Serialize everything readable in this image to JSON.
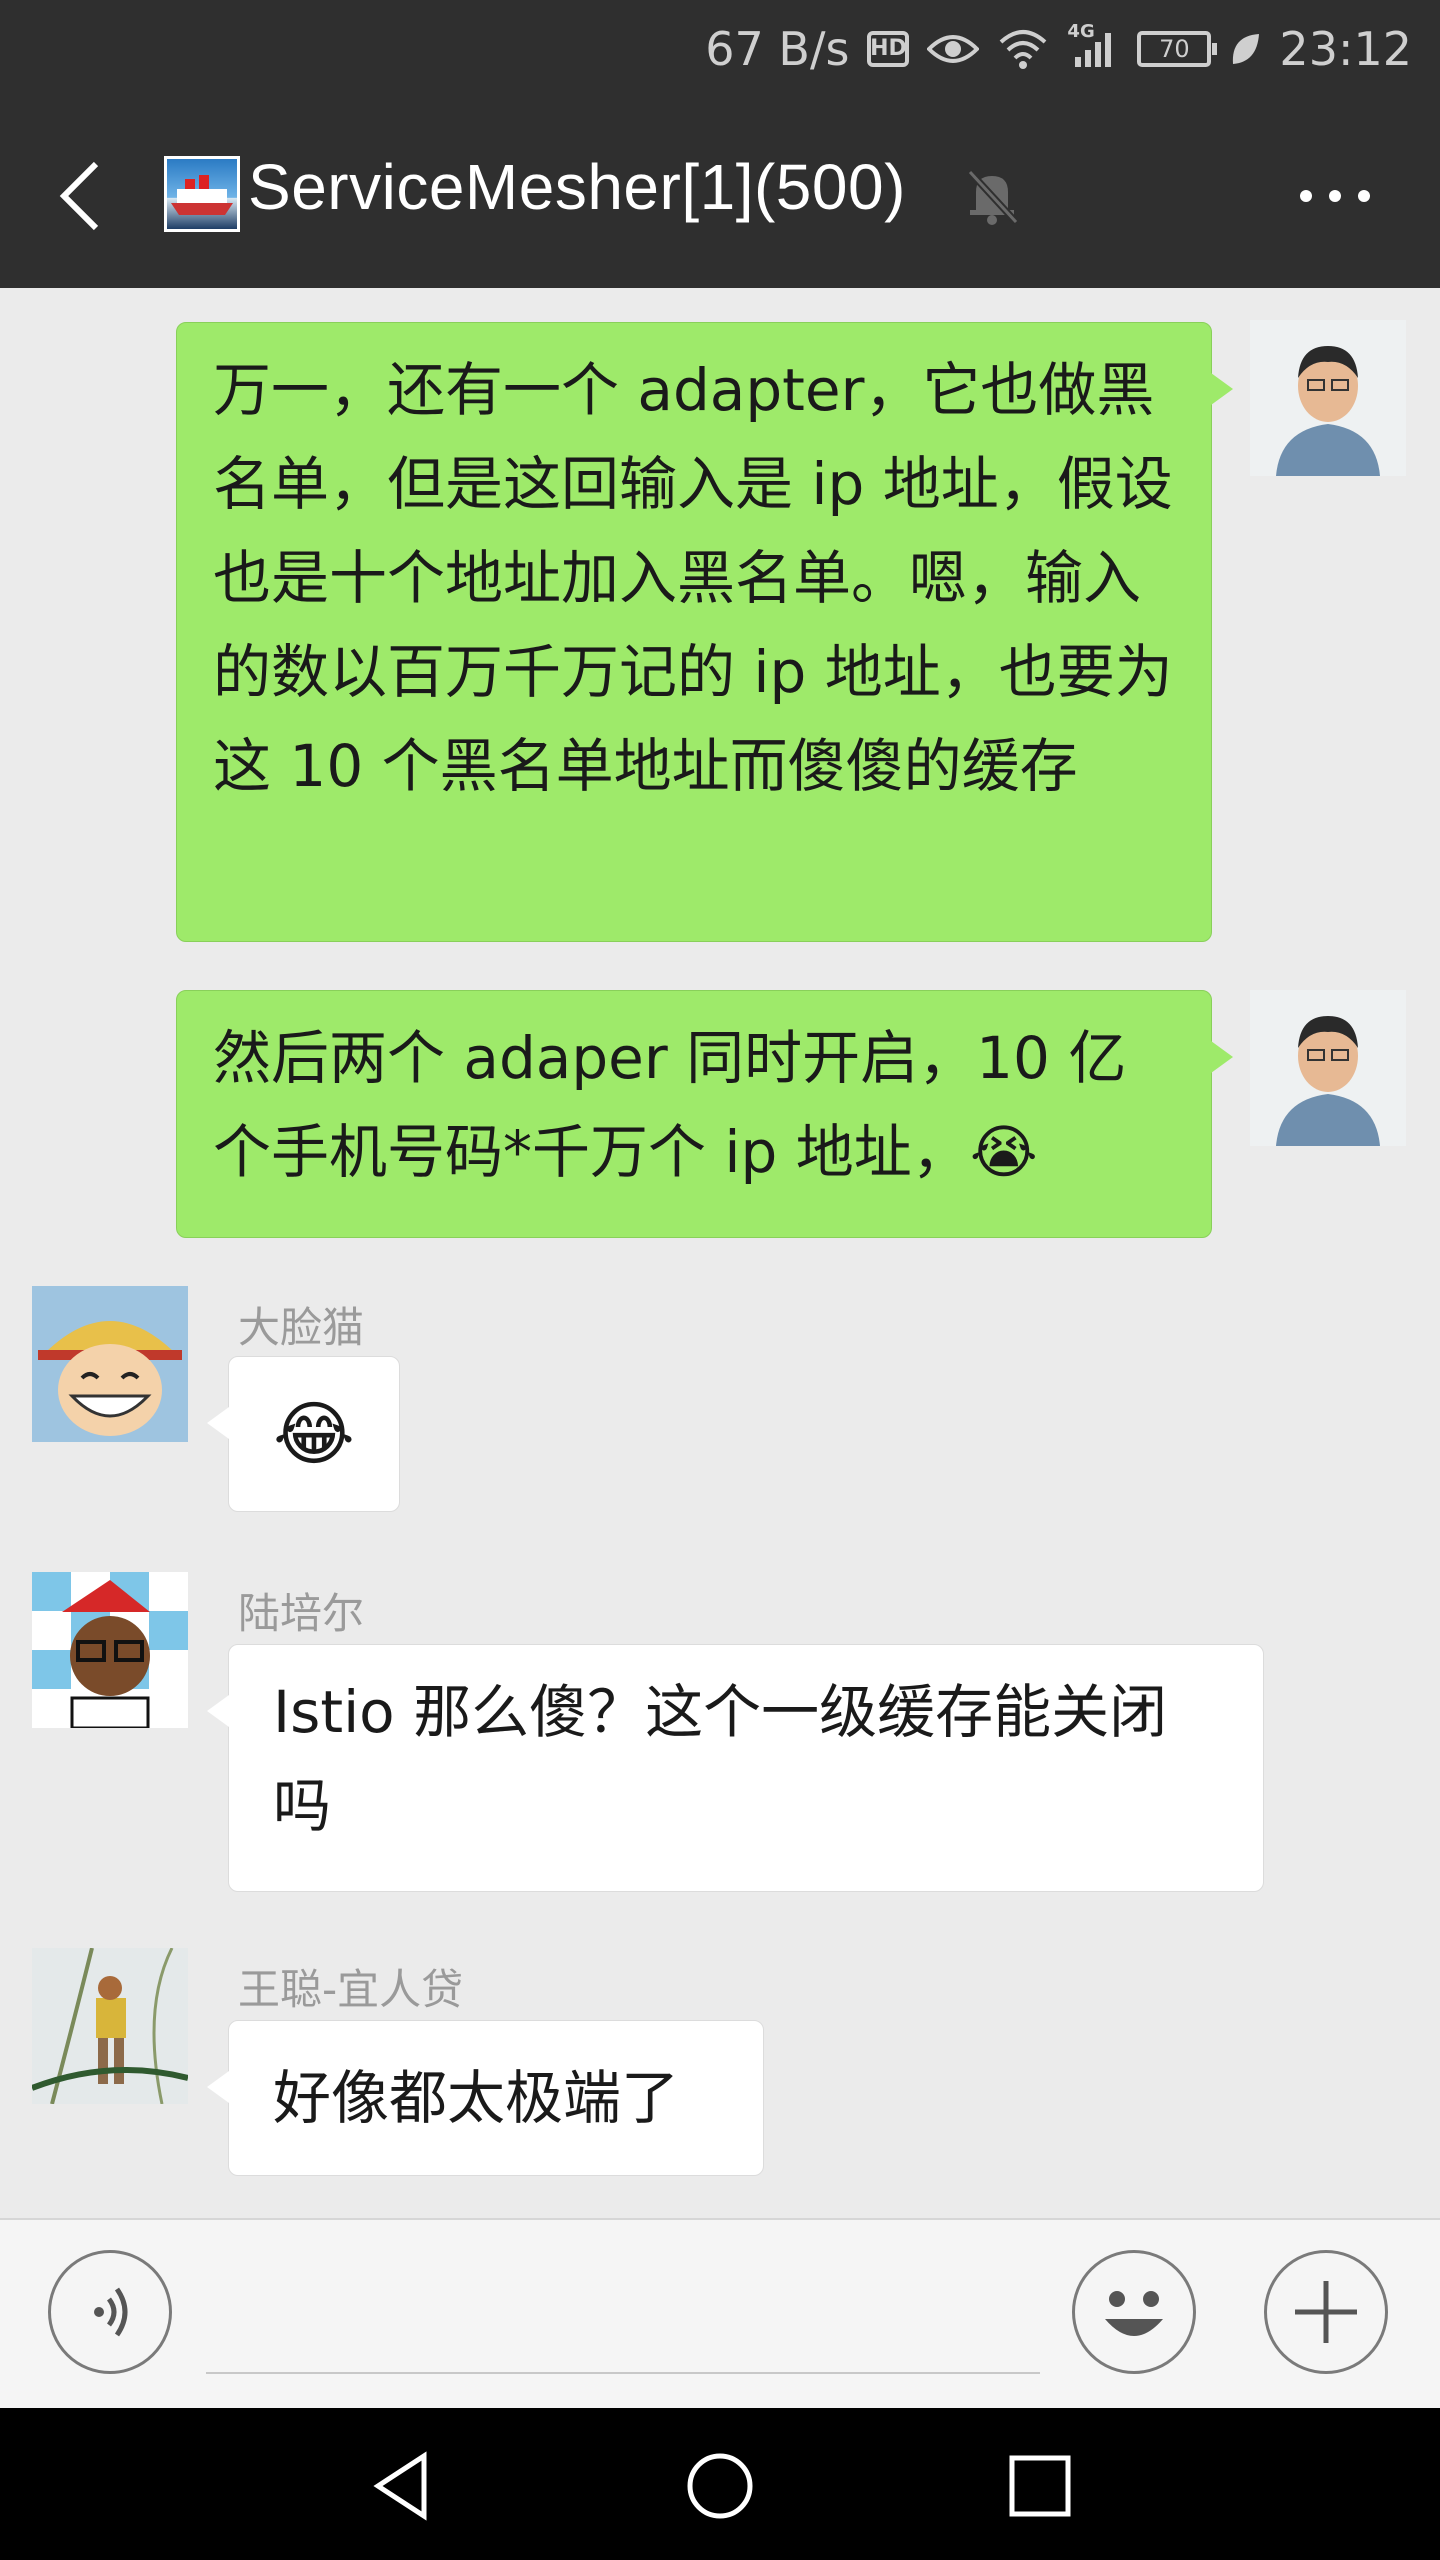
{
  "status_bar": {
    "net_speed": "67 B/s",
    "hd_label": "HD",
    "network_label": "4G",
    "battery": "70",
    "time": "23:12",
    "icons": [
      "hd-icon",
      "eye-icon",
      "wifi-icon",
      "signal-icon",
      "battery-icon",
      "leaf-icon"
    ]
  },
  "header": {
    "title": "ServiceMesher[1](500)",
    "icons": [
      "back-arrow-icon",
      "group-avatar-icon",
      "mute-bell-icon",
      "more-dots-icon"
    ]
  },
  "messages": [
    {
      "side": "right",
      "sender": "",
      "text": "万一，还有一个 adapter，它也做黑名单，但是这回输入是 ip 地址，假设也是十个地址加入黑名单。嗯，输入的数以百万千万记的 ip 地址，也要为这 10 个黑名单地址而傻傻的缓存"
    },
    {
      "side": "right",
      "sender": "",
      "text": "然后两个 adaper 同时开启，10 亿个手机号码*千万个 ip 地址，",
      "emoji": "😭"
    },
    {
      "side": "left",
      "sender": "大脸猫",
      "text": "",
      "emoji": "😂"
    },
    {
      "side": "left",
      "sender": "陆培尔",
      "text": "Istio 那么傻？这个一级缓存能关闭吗"
    },
    {
      "side": "left",
      "sender": "王聪-宜人贷",
      "text": "好像都太极端了"
    }
  ],
  "input_bar": {
    "icons": [
      "voice-icon",
      "emoji-icon",
      "plus-icon"
    ]
  },
  "nav_bar": {
    "icons": [
      "nav-back-icon",
      "nav-home-icon",
      "nav-recents-icon"
    ]
  },
  "colors": {
    "header_bg": "#2f2f2f",
    "chat_bg": "#ebebeb",
    "own_bubble": "#9eea6a",
    "other_bubble": "#ffffff"
  }
}
